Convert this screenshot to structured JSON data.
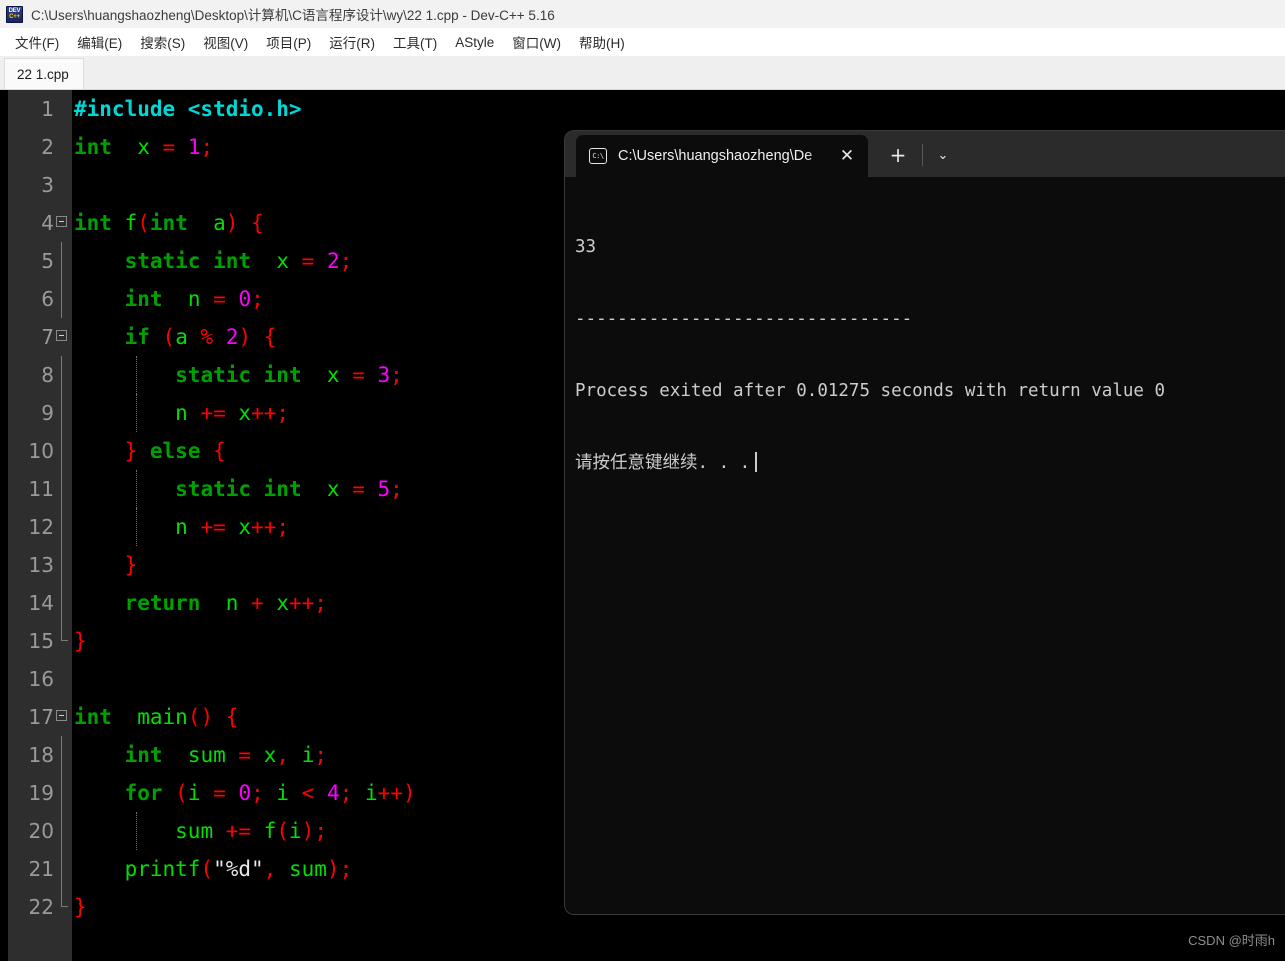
{
  "window": {
    "title": "C:\\Users\\huangshaozheng\\Desktop\\计算机\\C语言程序设计\\wy\\22 1.cpp - Dev-C++ 5.16",
    "app_icon_line1": "DEV",
    "app_icon_line2": "C++"
  },
  "menubar": {
    "items": [
      {
        "label": "文件(F)"
      },
      {
        "label": "编辑(E)"
      },
      {
        "label": "搜索(S)"
      },
      {
        "label": "视图(V)"
      },
      {
        "label": "项目(P)"
      },
      {
        "label": "运行(R)"
      },
      {
        "label": "工具(T)"
      },
      {
        "label": "AStyle"
      },
      {
        "label": "窗口(W)"
      },
      {
        "label": "帮助(H)"
      }
    ]
  },
  "editor": {
    "tab_label": "22 1.cpp",
    "lines": [
      {
        "n": "1",
        "text": "#include <stdio.h>"
      },
      {
        "n": "2",
        "text": "int  x = 1;"
      },
      {
        "n": "3",
        "text": ""
      },
      {
        "n": "4",
        "text": "int f(int  a) {"
      },
      {
        "n": "5",
        "text": "    static int  x = 2;"
      },
      {
        "n": "6",
        "text": "    int  n = 0;"
      },
      {
        "n": "7",
        "text": "    if (a % 2) {"
      },
      {
        "n": "8",
        "text": "        static int  x = 3;"
      },
      {
        "n": "9",
        "text": "        n += x++;"
      },
      {
        "n": "10",
        "text": "    } else {"
      },
      {
        "n": "11",
        "text": "        static int  x = 5;"
      },
      {
        "n": "12",
        "text": "        n += x++;"
      },
      {
        "n": "13",
        "text": "    }"
      },
      {
        "n": "14",
        "text": "    return  n + x++;"
      },
      {
        "n": "15",
        "text": "}"
      },
      {
        "n": "16",
        "text": ""
      },
      {
        "n": "17",
        "text": "int  main() {"
      },
      {
        "n": "18",
        "text": "    int  sum = x, i;"
      },
      {
        "n": "19",
        "text": "    for (i = 0; i < 4; i++)"
      },
      {
        "n": "20",
        "text": "        sum += f(i);"
      },
      {
        "n": "21",
        "text": "    printf(\"%d\", sum);"
      },
      {
        "n": "22",
        "text": "}"
      }
    ],
    "colors": {
      "background": "#000000",
      "gutter": "#2e2e2e",
      "line_number": "#9a9a9a",
      "keyword": "#00a000",
      "identifier": "#00e000",
      "number": "#ff00ff",
      "punctuation": "#ff0000",
      "preprocessor": "#00d8d8",
      "string": "#e8e8e8"
    }
  },
  "console": {
    "tab_title": "C:\\Users\\huangshaozheng\\De",
    "tab_icon": "terminal-icon",
    "close_label": "✕",
    "new_tab_label": "+",
    "chevron_label": "⌄",
    "output": [
      "33",
      "--------------------------------",
      "Process exited after 0.01275 seconds with return value 0",
      "请按任意键继续. . ."
    ],
    "colors": {
      "background": "#0c0c0c",
      "tabstrip": "#2b2b2b",
      "text": "#cccccc"
    }
  },
  "watermark": {
    "text": "CSDN @时雨h"
  }
}
